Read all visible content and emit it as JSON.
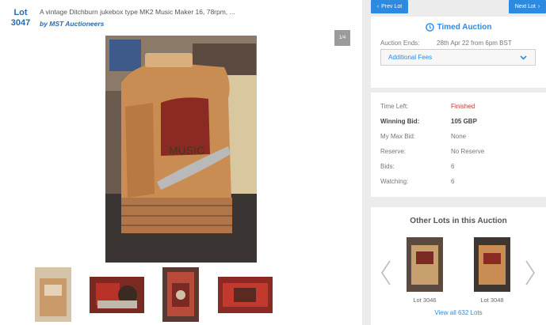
{
  "lot": {
    "prefix": "Lot",
    "number": "3047",
    "title": "A vintage Ditchburn jukebox type MK2 Music Maker 16, 78rpm, ...",
    "auctioneer": "by MST Auctioneers",
    "image_counter": "1/4"
  },
  "nav": {
    "prev_label": "Prev Lot",
    "next_label": "Next Lot"
  },
  "auction": {
    "type_label": "Timed Auction",
    "ends_label": "Auction Ends:",
    "ends_value": "28th Apr 22 from 6pm BST",
    "fees_label": "Additional Fees"
  },
  "details": {
    "time_left_label": "Time Left:",
    "time_left_value": "Finished",
    "winning_bid_label": "Winning Bid:",
    "winning_bid_value": "105 GBP",
    "max_bid_label": "My Max Bid:",
    "max_bid_value": "None",
    "reserve_label": "Reserve:",
    "reserve_value": "No Reserve",
    "bids_label": "Bids:",
    "bids_value": "6",
    "watching_label": "Watching:",
    "watching_value": "6"
  },
  "other_lots": {
    "title": "Other Lots in this Auction",
    "items": [
      {
        "label": "Lot 3046"
      },
      {
        "label": "Lot 3048"
      }
    ],
    "view_all": "View all 632 Lots"
  },
  "colors": {
    "accent": "#2c8ae0",
    "finished": "#c0392b",
    "lot_number": "#2b6aa8"
  }
}
